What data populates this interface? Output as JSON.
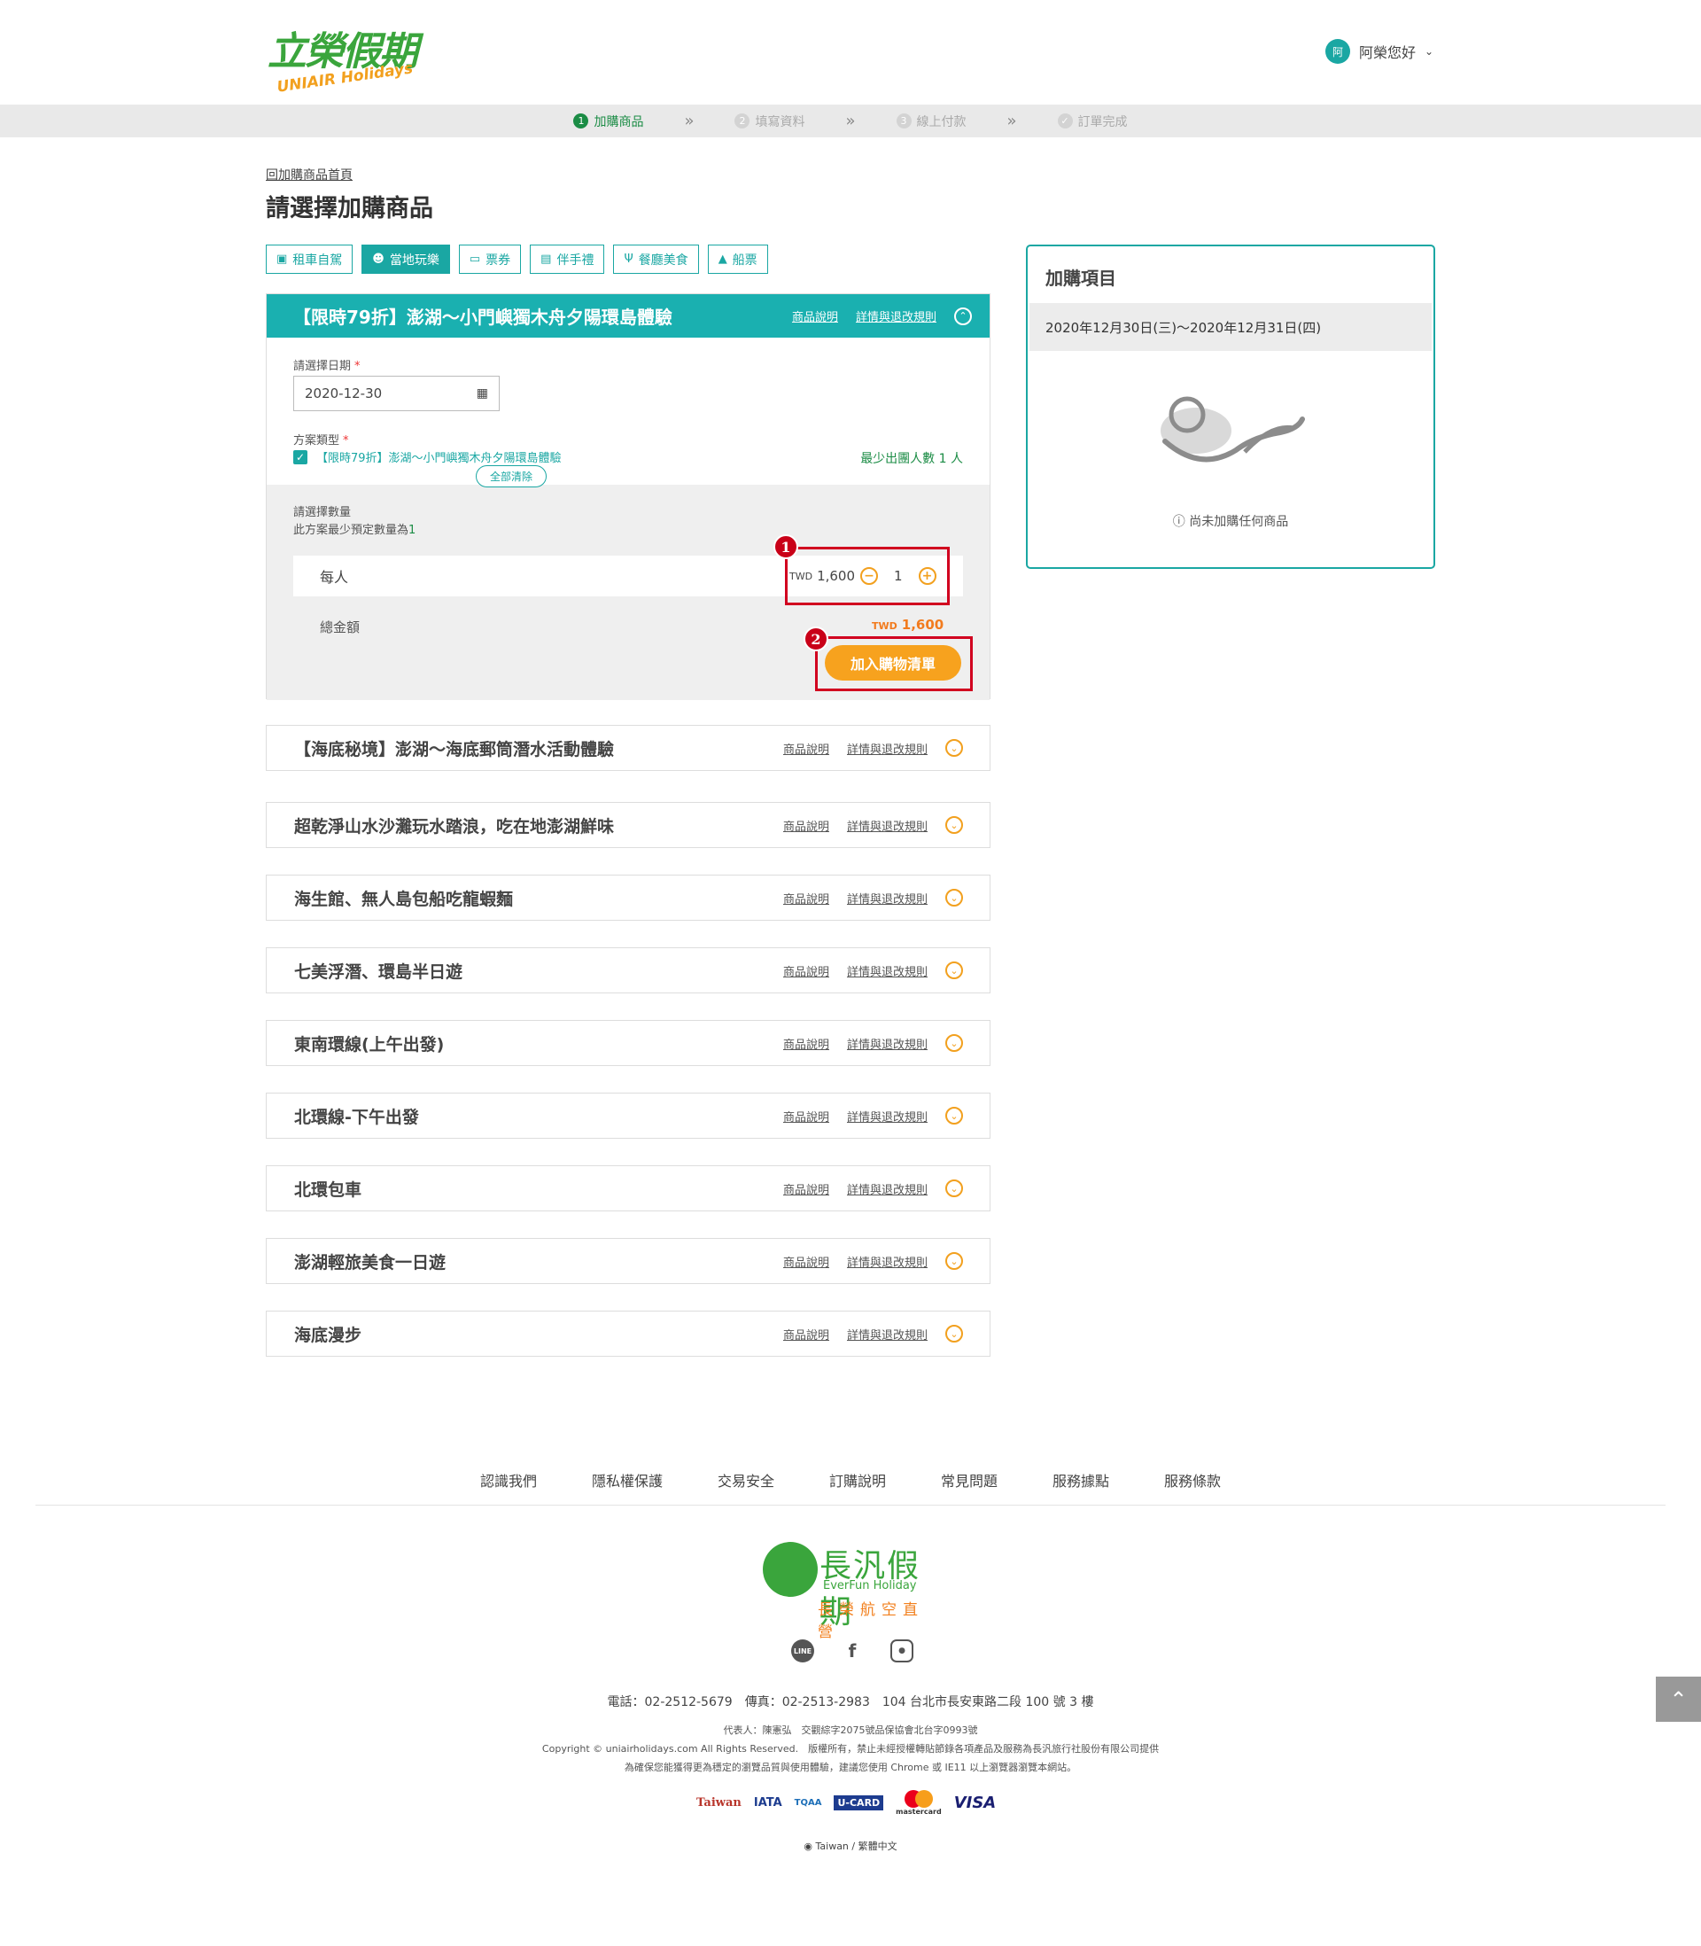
{
  "header": {
    "logo_zh": "立榮假期",
    "logo_en": "UNIAIR Holidays",
    "user_avatar": "阿",
    "user_greeting": "阿榮您好"
  },
  "steps": [
    {
      "num": "1",
      "label": "加購商品",
      "active": true
    },
    {
      "num": "2",
      "label": "填寫資料",
      "active": false
    },
    {
      "num": "3",
      "label": "線上付款",
      "active": false
    },
    {
      "num": "✓",
      "label": "訂單完成",
      "active": false
    }
  ],
  "back_link": "回加購商品首頁",
  "page_title": "請選擇加購商品",
  "categories": [
    {
      "icon": "car-icon",
      "label": "租車自駕"
    },
    {
      "icon": "people-icon",
      "label": "當地玩樂"
    },
    {
      "icon": "ticket-icon",
      "label": "票券"
    },
    {
      "icon": "gift-icon",
      "label": "伴手禮"
    },
    {
      "icon": "fork-knife-icon",
      "label": "餐廳美食"
    },
    {
      "icon": "boat-icon",
      "label": "船票"
    }
  ],
  "active_category": "當地玩樂",
  "expanded_product": {
    "title": "【限時79折】澎湖～小門嶼獨木舟夕陽環島體驗",
    "link_desc": "商品說明",
    "link_rules": "詳情與退改規則",
    "date_label": "請選擇日期",
    "date_value": "2020-12-30",
    "plan_label": "方案類型",
    "plan_name": "【限時79折】澎湖～小門嶼獨木舟夕陽環島體驗",
    "min_group": "最少出團人數 1 人",
    "qty_label": "請選擇數量",
    "qty_min_text": "此方案最少預定數量為",
    "qty_min_value": "1",
    "row_label": "每人",
    "currency": "TWD",
    "unit_price": "1,600",
    "quantity": "1",
    "total_label": "總金額",
    "total_price": "1,600",
    "clear_button": "全部清除",
    "add_button": "加入購物清單",
    "annotation_1": "1",
    "annotation_2": "2"
  },
  "products": [
    {
      "title": "【海底秘境】澎湖～海底郵筒潛水活動體驗"
    },
    {
      "title": "超乾淨山水沙灘玩水踏浪，吃在地澎湖鮮味"
    },
    {
      "title": "海生館、無人島包船吃龍蝦麵"
    },
    {
      "title": "七美浮潛、環島半日遊"
    },
    {
      "title": "東南環線(上午出發)"
    },
    {
      "title": "北環線-下午出發"
    },
    {
      "title": "北環包車"
    },
    {
      "title": "澎湖輕旅美食一日遊"
    },
    {
      "title": "海底漫步"
    }
  ],
  "product_link_desc": "商品說明",
  "product_link_rules": "詳情與退改規則",
  "cart": {
    "title": "加購項目",
    "date_range": "2020年12月30日(三)～2020年12月31日(四)",
    "empty_text": "尚未加購任何商品"
  },
  "footer": {
    "nav": [
      "認識我們",
      "隱私權保護",
      "交易安全",
      "訂購說明",
      "常見問題",
      "服務據點",
      "服務條款"
    ],
    "logo_zh": "長汎假期",
    "logo_en": "EverFun Holiday",
    "logo_sub": "長榮航空直營",
    "contact": "電話：02-2512-5679　傳真：02-2513-2983　104 台北市長安東路二段 100 號 3 樓",
    "rep": "代表人：陳憲弘　交觀綜字2075號品保協會北台字0993號",
    "copyright": "Copyright © uniairholidays.com All Rights Reserved.　版權所有，禁止未經授權轉貼節錄各項產品及服務為長汎旅行社股份有限公司提供",
    "browser": "為確保您能獲得更為穩定的瀏覽品質與使用體驗，建議您使用 Chrome 或 IE11 以上瀏覽器瀏覽本網站。",
    "payments": [
      "Taiwan",
      "IATA",
      "TQAA",
      "U-CARD",
      "mastercard",
      "VISA"
    ],
    "lang": "Taiwan / 繁體中文"
  },
  "colors": {
    "teal": "#1ab0b0",
    "green": "#1b8c45",
    "orange": "#f7a21e",
    "red_annot": "#d1001f"
  }
}
